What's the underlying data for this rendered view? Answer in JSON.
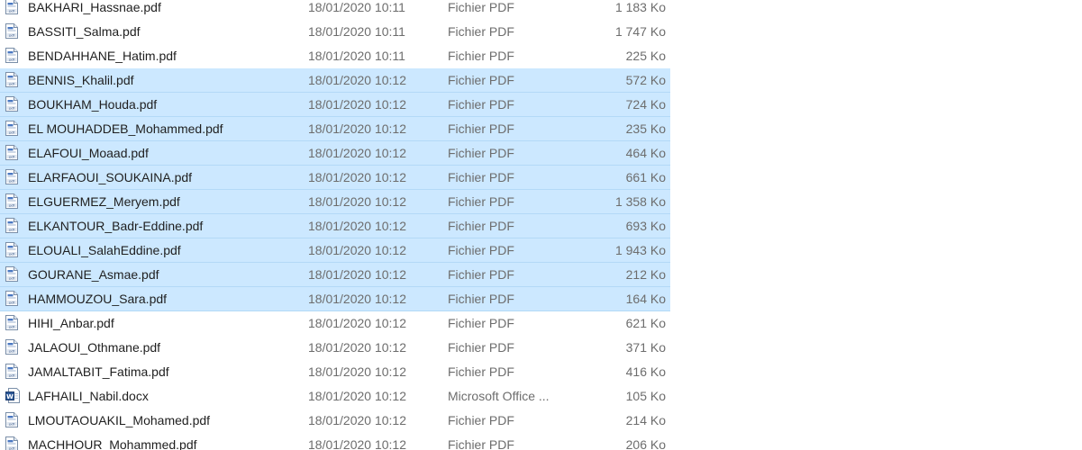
{
  "files": [
    {
      "name": "BAKHARI_Hassnae.pdf",
      "date": "18/01/2020 10:11",
      "type": "Fichier PDF",
      "size": "1 183 Ko",
      "icon": "pdf-file-icon",
      "selected": false
    },
    {
      "name": "BASSITI_Salma.pdf",
      "date": "18/01/2020 10:11",
      "type": "Fichier PDF",
      "size": "1 747 Ko",
      "icon": "pdf-file-icon",
      "selected": false
    },
    {
      "name": "BENDAHHANE_Hatim.pdf",
      "date": "18/01/2020 10:11",
      "type": "Fichier PDF",
      "size": "225 Ko",
      "icon": "pdf-file-icon",
      "selected": false
    },
    {
      "name": "BENNIS_Khalil.pdf",
      "date": "18/01/2020 10:12",
      "type": "Fichier PDF",
      "size": "572 Ko",
      "icon": "pdf-file-icon",
      "selected": true
    },
    {
      "name": "BOUKHAM_Houda.pdf",
      "date": "18/01/2020 10:12",
      "type": "Fichier PDF",
      "size": "724 Ko",
      "icon": "pdf-file-icon",
      "selected": true
    },
    {
      "name": "EL MOUHADDEB_Mohammed.pdf",
      "date": "18/01/2020 10:12",
      "type": "Fichier PDF",
      "size": "235 Ko",
      "icon": "pdf-file-icon",
      "selected": true
    },
    {
      "name": "ELAFOUI_Moaad.pdf",
      "date": "18/01/2020 10:12",
      "type": "Fichier PDF",
      "size": "464 Ko",
      "icon": "pdf-file-icon",
      "selected": true
    },
    {
      "name": "ELARFAOUI_SOUKAINA.pdf",
      "date": "18/01/2020 10:12",
      "type": "Fichier PDF",
      "size": "661 Ko",
      "icon": "pdf-file-icon",
      "selected": true
    },
    {
      "name": "ELGUERMEZ_Meryem.pdf",
      "date": "18/01/2020 10:12",
      "type": "Fichier PDF",
      "size": "1 358 Ko",
      "icon": "pdf-file-icon",
      "selected": true
    },
    {
      "name": "ELKANTOUR_Badr-Eddine.pdf",
      "date": "18/01/2020 10:12",
      "type": "Fichier PDF",
      "size": "693 Ko",
      "icon": "pdf-file-icon",
      "selected": true
    },
    {
      "name": "ELOUALI_SalahEddine.pdf",
      "date": "18/01/2020 10:12",
      "type": "Fichier PDF",
      "size": "1 943 Ko",
      "icon": "pdf-file-icon",
      "selected": true
    },
    {
      "name": "GOURANE_Asmae.pdf",
      "date": "18/01/2020 10:12",
      "type": "Fichier PDF",
      "size": "212 Ko",
      "icon": "pdf-file-icon",
      "selected": true
    },
    {
      "name": "HAMMOUZOU_Sara.pdf",
      "date": "18/01/2020 10:12",
      "type": "Fichier PDF",
      "size": "164 Ko",
      "icon": "pdf-file-icon",
      "selected": true
    },
    {
      "name": "HIHI_Anbar.pdf",
      "date": "18/01/2020 10:12",
      "type": "Fichier PDF",
      "size": "621 Ko",
      "icon": "pdf-file-icon",
      "selected": false
    },
    {
      "name": "JALAOUI_Othmane.pdf",
      "date": "18/01/2020 10:12",
      "type": "Fichier PDF",
      "size": "371 Ko",
      "icon": "pdf-file-icon",
      "selected": false
    },
    {
      "name": "JAMALTABIT_Fatima.pdf",
      "date": "18/01/2020 10:12",
      "type": "Fichier PDF",
      "size": "416 Ko",
      "icon": "pdf-file-icon",
      "selected": false
    },
    {
      "name": "LAFHAILI_Nabil.docx",
      "date": "18/01/2020 10:12",
      "type": "Microsoft Office ...",
      "size": "105 Ko",
      "icon": "word-document-icon",
      "selected": false
    },
    {
      "name": "LMOUTAOUAKIL_Mohamed.pdf",
      "date": "18/01/2020 10:12",
      "type": "Fichier PDF",
      "size": "214 Ko",
      "icon": "pdf-file-icon",
      "selected": false
    },
    {
      "name": "MACHHOUR_Mohammed.pdf",
      "date": "18/01/2020 10:12",
      "type": "Fichier PDF",
      "size": "206 Ko",
      "icon": "pdf-file-icon",
      "selected": false
    }
  ],
  "colors": {
    "selection_background": "#cce8ff",
    "selection_border": "#b3d9f7",
    "secondary_text": "#6d6d6d",
    "primary_text": "#1f1f1f"
  }
}
